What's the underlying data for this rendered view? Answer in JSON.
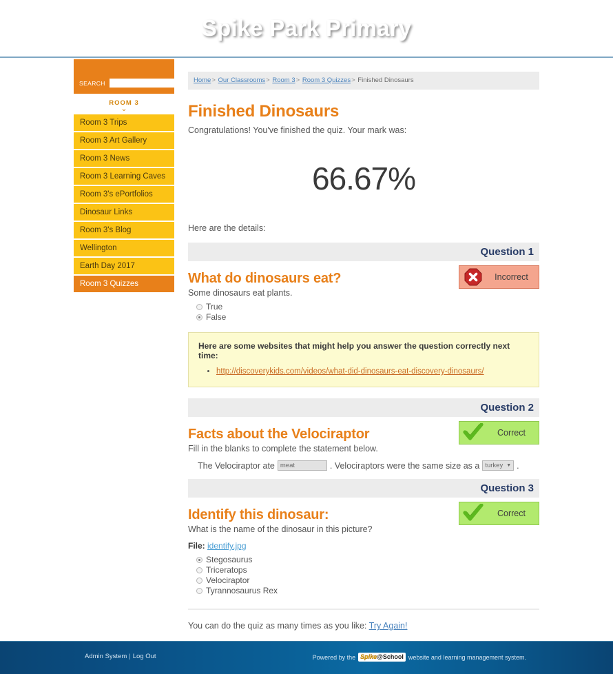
{
  "header": {
    "site_title": "Spike Park Primary"
  },
  "sidebar": {
    "search": {
      "label": "SEARCH",
      "value": "",
      "placeholder": "",
      "go_icon": "chevron-right-icon"
    },
    "section_label": "ROOM 3",
    "section_chevron": "ˇ",
    "items": [
      {
        "label": "Room 3 Trips",
        "active": false
      },
      {
        "label": "Room 3 Art Gallery",
        "active": false
      },
      {
        "label": "Room 3 News",
        "active": false
      },
      {
        "label": "Room 3 Learning Caves",
        "active": false
      },
      {
        "label": "Room 3's ePortfolios",
        "active": false
      },
      {
        "label": "Dinosaur Links",
        "active": false
      },
      {
        "label": "Room 3's Blog",
        "active": false
      },
      {
        "label": "Wellington",
        "active": false
      },
      {
        "label": "Earth Day 2017",
        "active": false
      },
      {
        "label": "Room 3 Quizzes",
        "active": true
      }
    ]
  },
  "breadcrumb": {
    "items": [
      "Home",
      "Our Classrooms",
      "Room 3",
      "Room 3 Quizzes",
      "Finished Dinosaurs"
    ],
    "separator": ">"
  },
  "main": {
    "page_title": "Finished Dinosaurs",
    "intro_text": "Congratulations! You've finished the quiz. Your mark was:",
    "score": "66.67%",
    "details_text": "Here are the details:",
    "retry_text": "You can do the quiz as many times as you like:",
    "retry_link": "Try Again!"
  },
  "questions": [
    {
      "number_label": "Question 1",
      "title": "What do dinosaurs eat?",
      "description": "Some dinosaurs eat plants.",
      "status": "Incorrect",
      "status_type": "incorrect",
      "status_icon": "x-octagon-icon",
      "answers": [
        {
          "label": "True",
          "selected": false
        },
        {
          "label": "False",
          "selected": true
        }
      ],
      "hint": {
        "title": "Here are some websites that might help you answer the question correctly next time:",
        "links": [
          "http://discoverykids.com/videos/what-did-dinosaurs-eat-discovery-dinosaurs/"
        ]
      }
    },
    {
      "number_label": "Question 2",
      "title": "Facts about the Velociraptor",
      "description": "Fill in the blanks to complete the statement below.",
      "status": "Correct",
      "status_type": "correct",
      "status_icon": "check-mark-icon",
      "fill": {
        "prefix": "The Velociraptor ate",
        "text_value": "meat",
        "middle": ". Velociraptors were the same size as a",
        "select_value": "turkey",
        "suffix": "."
      }
    },
    {
      "number_label": "Question 3",
      "title": "Identify this dinosaur:",
      "description": "What is the name of the dinosaur in this picture?",
      "status": "Correct",
      "status_type": "correct",
      "status_icon": "check-mark-icon",
      "file_label": "File:",
      "file_name": "identify.jpg",
      "answers": [
        {
          "label": "Stegosaurus",
          "selected": true
        },
        {
          "label": "Triceratops",
          "selected": false
        },
        {
          "label": "Velociraptor",
          "selected": false
        },
        {
          "label": "Tyrannosaurus Rex",
          "selected": false
        }
      ]
    }
  ],
  "footer": {
    "admin_link": "Admin System",
    "pipe": "|",
    "logout_link": "Log Out",
    "powered_prefix": "Powered by the",
    "logo_spike": "Spike",
    "logo_at_school": "@School",
    "powered_suffix": "website and learning management system."
  },
  "colors": {
    "header_blue_dark": "#0a4473",
    "header_blue_light": "#0d79b6",
    "orange": "#e8801a",
    "yellow": "#fbc315",
    "correct_green": "#b2ea6e",
    "incorrect_red": "#f4a58e",
    "hint_yellow": "#fdfbd0"
  }
}
